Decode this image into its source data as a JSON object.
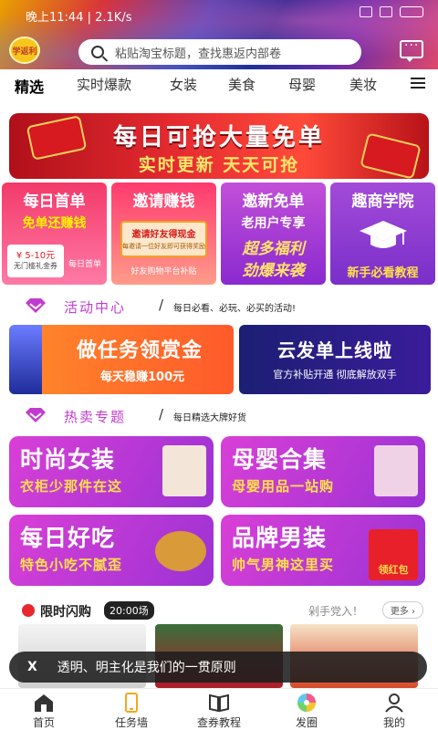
{
  "status": {
    "time": "晚上11:44",
    "speed": "2.1K/s"
  },
  "header": {
    "logo_text": "学返利",
    "search_placeholder": "粘贴淘宝标题，查找惠返内部卷",
    "accent": "#c23bd0"
  },
  "tabs": [
    "精选",
    "实时爆款",
    "女装",
    "美食",
    "母婴",
    "美妆"
  ],
  "banner": {
    "title": "每日可抢大量免单",
    "subtitle": "实时更新  天天可抢"
  },
  "feature_cards": [
    {
      "title": "每日首单",
      "subtitle": "免单还赚钱",
      "coupon": "¥ 5-10元",
      "coupon_note": "无门槛礼金券",
      "tag": "每日首单"
    },
    {
      "title": "邀请赚钱",
      "box_title": "邀请好友得现金",
      "box_note": "每邀请一位好友即可获得奖励",
      "footer": "好友购物平台补贴"
    },
    {
      "title": "邀新免单",
      "subtitle": "老用户专享",
      "line1": "超多福利",
      "line2": "劲爆来袭"
    },
    {
      "title": "趣商学院",
      "footer": "新手必看教程"
    }
  ],
  "activity_section": {
    "title": "活动中心",
    "desc": "每日必看、必玩、必买的活动!"
  },
  "activities": [
    {
      "title": "做任务领赏金",
      "subtitle": "每天稳赚100元"
    },
    {
      "title": "云发单上线啦",
      "subtitle": "官方补贴开通  彻底解放双手"
    }
  ],
  "hot_section": {
    "title": "热卖专题",
    "desc": "每日精选大牌好货"
  },
  "hot_cards": [
    {
      "title": "时尚女装",
      "subtitle": "衣柜少那件在这"
    },
    {
      "title": "母婴合集",
      "subtitle": "母婴用品一站购"
    },
    {
      "title": "每日好吃",
      "subtitle": "特色小吃不腻歪"
    },
    {
      "title": "品牌男装",
      "subtitle": "帅气男神这里买",
      "badge": "领红包"
    }
  ],
  "flash_sale": {
    "title": "限时闪购",
    "time": "20:00场",
    "slogan": "剁手党入！",
    "more": "更多"
  },
  "toast": {
    "close": "X",
    "message": "透明、明主化是我们的一贯原则"
  },
  "bottom_nav": [
    {
      "label": "首页",
      "icon": "home-icon"
    },
    {
      "label": "任务墙",
      "icon": "phone-icon"
    },
    {
      "label": "查券教程",
      "icon": "book-icon"
    },
    {
      "label": "发圈",
      "icon": "aperture-icon"
    },
    {
      "label": "我的",
      "icon": "user-icon"
    }
  ]
}
